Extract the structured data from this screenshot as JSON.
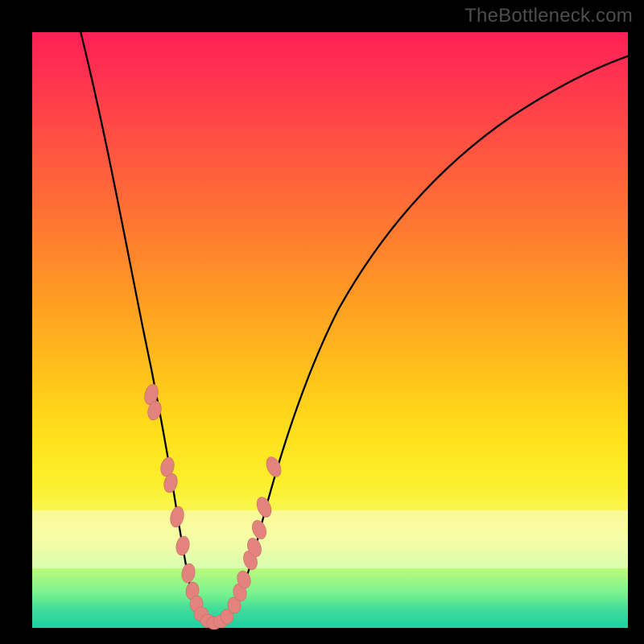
{
  "watermark": "TheBottleneck.com",
  "colors": {
    "frame": "#000000",
    "curve": "#000000",
    "dot_fill": "#e2837e",
    "dot_stroke": "#c96a65"
  },
  "chart_data": {
    "type": "line",
    "title": "",
    "xlabel": "",
    "ylabel": "",
    "xlim": [
      0,
      100
    ],
    "ylim": [
      0,
      100
    ],
    "grid": false,
    "legend": false,
    "series": [
      {
        "name": "bottleneck-curve",
        "x": [
          8,
          10,
          12,
          14,
          16,
          18,
          20,
          22,
          24,
          25,
          26,
          27,
          28,
          29,
          30,
          32,
          34,
          36,
          38,
          42,
          46,
          50,
          55,
          60,
          65,
          70,
          75,
          80,
          85,
          90,
          95,
          100
        ],
        "y": [
          100,
          90,
          80,
          71,
          62,
          53,
          45,
          37,
          28,
          22,
          17,
          12,
          8,
          5,
          3,
          1,
          2,
          5,
          10,
          20,
          30,
          38,
          47,
          54,
          60,
          66,
          71,
          76,
          80,
          84,
          87,
          90
        ]
      }
    ],
    "highlight_points": {
      "name": "sample-dots",
      "x": [
        20.0,
        20.5,
        23.0,
        23.5,
        24.5,
        25.5,
        26.5,
        27.0,
        27.5,
        28.0,
        29.0,
        30.0,
        30.5,
        31.0,
        32.5,
        33.5,
        34.0,
        35.5,
        36.0,
        36.5,
        37.0,
        38.5
      ],
      "y": [
        40,
        38,
        30,
        27,
        20,
        15,
        10,
        7,
        5,
        3,
        2,
        1,
        1,
        2,
        3,
        5,
        7,
        10,
        12,
        17,
        22,
        36
      ]
    },
    "pale_band_y": [
      10,
      20
    ]
  }
}
